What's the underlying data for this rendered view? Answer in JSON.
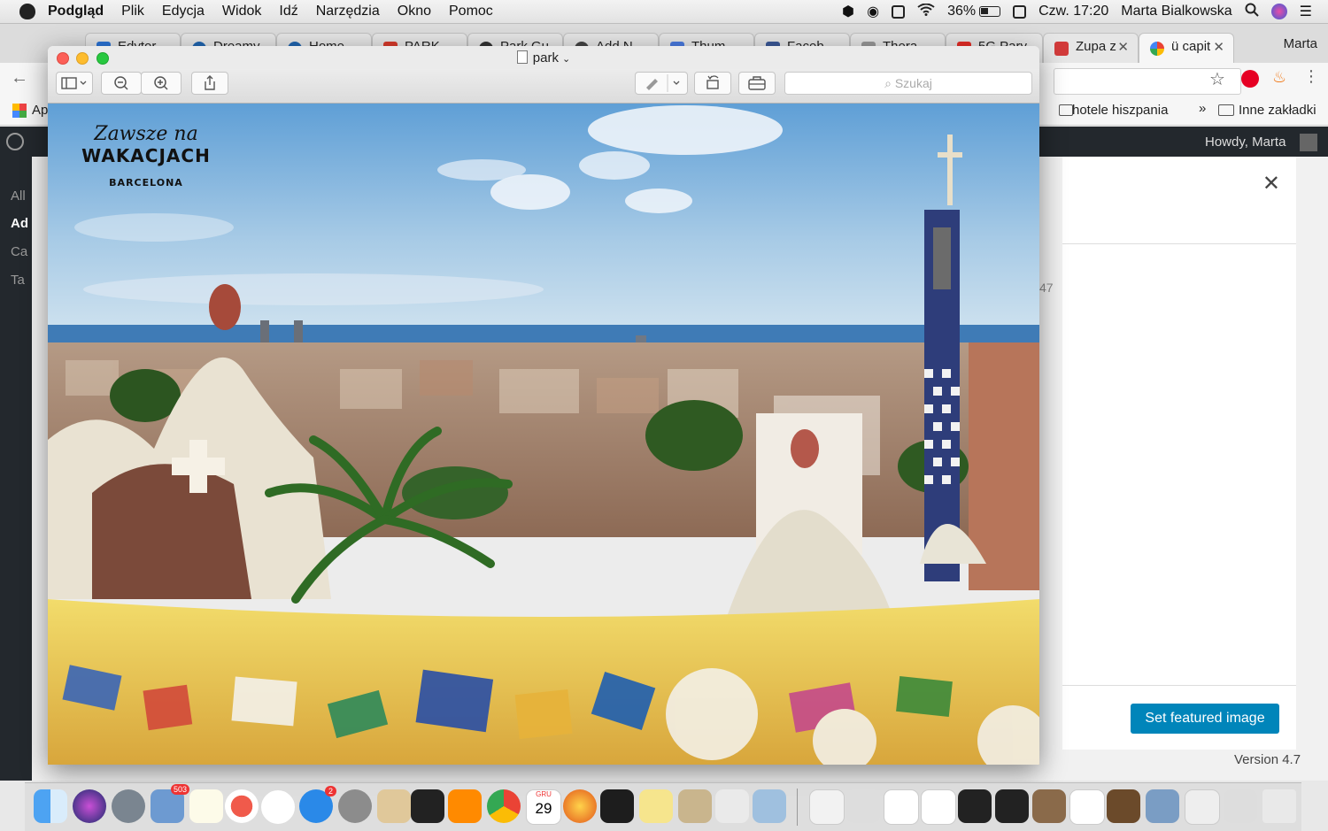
{
  "menubar": {
    "app": "Podgląd",
    "items": [
      "Plik",
      "Edycja",
      "Widok",
      "Idź",
      "Narzędzia",
      "Okno",
      "Pomoc"
    ],
    "battery": "36%",
    "datetime": "Czw. 17:20",
    "user": "Marta Bialkowska"
  },
  "chrome": {
    "tabs": [
      "Edytor...",
      "Dreamy",
      "Home ...",
      "PARK ...",
      "Park Gu...",
      "Add N...",
      "Thum...",
      "Faceb...",
      "Thera...",
      "5G Pary...",
      "Zupa z",
      "ü capit"
    ],
    "profile": "Marta",
    "bookmarks": {
      "apps": "Ap",
      "hotele": "hotele hiszpania",
      "more": "»",
      "other": "Inne zakładki"
    }
  },
  "wordpress": {
    "howdy": "Howdy, Marta",
    "side_labels": [
      "All",
      "Ad",
      "Ca",
      "Ta"
    ],
    "featured_button": "Set featured image",
    "version": "Version 4.7",
    "number_fragment": "47"
  },
  "preview": {
    "title": "park",
    "search_placeholder": "Szukaj",
    "photo_text": {
      "script": "Zawsze na",
      "brand": "WAKACJACH",
      "city": "BARCELONA"
    }
  },
  "dock": {
    "mail_badge": "503",
    "appstore_badge": "2",
    "calendar_month": "GRU",
    "calendar_day": "29"
  },
  "colors": {
    "wp_primary": "#0085ba",
    "wp_dark": "#23282d",
    "sky": "#6aa7d8",
    "sea": "#2f6aa6"
  }
}
